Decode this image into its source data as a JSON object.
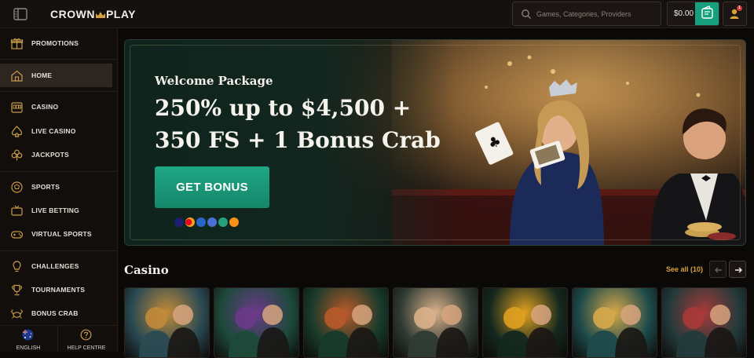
{
  "header": {
    "logo_text_left": "CROWN",
    "logo_text_right": "PLAY",
    "search_placeholder": "Games, Categories, Providers",
    "balance": "$0.00",
    "notification_count": "1"
  },
  "sidebar": {
    "items": [
      {
        "label": "PROMOTIONS",
        "icon": "gift-icon"
      },
      {
        "label": "HOME",
        "icon": "home-icon",
        "active": true
      },
      {
        "label": "CASINO",
        "icon": "slot-machine-icon"
      },
      {
        "label": "LIVE CASINO",
        "icon": "spade-icon"
      },
      {
        "label": "JACKPOTS",
        "icon": "clover-icon"
      },
      {
        "label": "SPORTS",
        "icon": "ball-icon"
      },
      {
        "label": "LIVE BETTING",
        "icon": "tv-icon"
      },
      {
        "label": "VIRTUAL SPORTS",
        "icon": "gamepad-icon"
      },
      {
        "label": "CHALLENGES",
        "icon": "lightbulb-icon"
      },
      {
        "label": "TOURNAMENTS",
        "icon": "trophy-icon"
      },
      {
        "label": "BONUS CRAB",
        "icon": "crab-icon"
      }
    ],
    "footer": {
      "language": "ENGLISH",
      "help": "HELP CENTRE"
    }
  },
  "hero": {
    "welcome": "Welcome Package",
    "offer_line1": "250% up to $4,500 +",
    "offer_line2": "350 FS + 1 Bonus Crab",
    "cta": "GET BONUS",
    "payment_icons": [
      "visa-icon",
      "mastercard-icon",
      "bank-icon",
      "crypto-icon",
      "tether-icon",
      "bitcoin-icon"
    ]
  },
  "casino": {
    "title": "Casino",
    "see_all": "See all (10)",
    "games": [
      {
        "theme": "viking",
        "color_a": "#2a4a52",
        "color_b": "#c28a3a"
      },
      {
        "theme": "zombie",
        "color_a": "#1d4a3a",
        "color_b": "#6b3a8a"
      },
      {
        "theme": "pirate",
        "color_a": "#173a2b",
        "color_b": "#b85a2a"
      },
      {
        "theme": "couple",
        "color_a": "#2e3b33",
        "color_b": "#d9b08a"
      },
      {
        "theme": "diamond",
        "color_a": "#14281f",
        "color_b": "#e0a020"
      },
      {
        "theme": "aztec",
        "color_a": "#1d4a4a",
        "color_b": "#d6a84a"
      },
      {
        "theme": "card-players",
        "color_a": "#233a3a",
        "color_b": "#a83a3a"
      }
    ]
  },
  "colors": {
    "accent_green": "#1fa683",
    "accent_gold": "#d9a23a",
    "background": "#0b0908"
  }
}
